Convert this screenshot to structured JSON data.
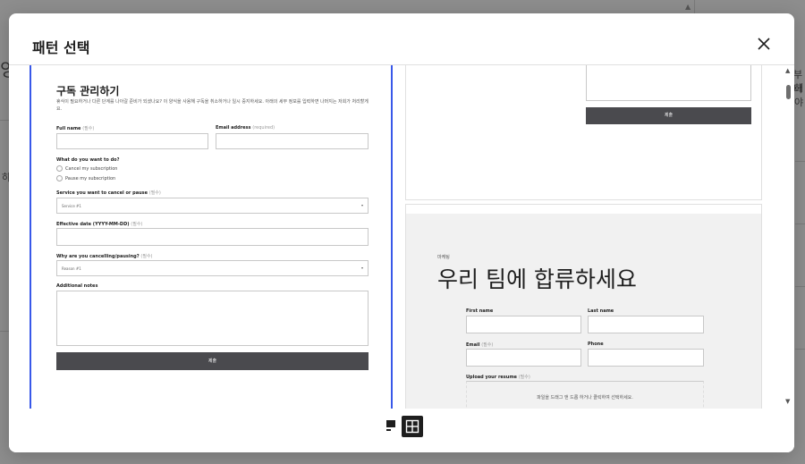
{
  "background": {
    "partial_text_1": "잉",
    "partial_text_2": "하",
    "partial_text_3": "부터",
    "partial_text_4": "해야"
  },
  "modal": {
    "title": "패턴 선택",
    "close_icon": "close-icon"
  },
  "pattern_left": {
    "title": "구독 관리하기",
    "description": "휴식이 필요하거나 다른 단계를 나아갈 준비가 되셨나요? 이 양식을 사용해 구독을 취소하거나 일시 중지하세요. 아래의 세부 정보를 입력하면 나머지는 저희가 처리할게요.",
    "full_name_label": "Full name",
    "full_name_opt": "(필수)",
    "email_label": "Email address",
    "email_opt": "(required)",
    "want_label": "What do you want to do?",
    "radio_options": [
      "Cancel my subscription",
      "Pause my subscription"
    ],
    "service_label": "Service you want to cancel or pause",
    "service_opt": "(필수)",
    "service_value": "Service #1",
    "date_label": "Effective date (YYYY-MM-DD)",
    "date_opt": "(필수)",
    "why_label": "Why are you cancelling/pausing?",
    "why_opt": "(필수)",
    "why_value": "Reason #1",
    "notes_label": "Additional notes",
    "submit_label": "제출"
  },
  "pattern_right_top": {
    "submit_label": "제출"
  },
  "pattern_right_bottom": {
    "eyebrow": "마케팅",
    "heading": "우리 팀에 합류하세요",
    "first_name_label": "First name",
    "last_name_label": "Last name",
    "email_label": "Email",
    "email_opt": "(필수)",
    "phone_label": "Phone",
    "resume_label": "Upload your resume",
    "resume_opt": "(필수)",
    "upload_text": "파일을 드래그 앤 드롭 하거나 클릭하여 선택하세요."
  },
  "footer": {
    "list_view_icon": "single-view-icon",
    "grid_view_icon": "grid-view-icon"
  }
}
